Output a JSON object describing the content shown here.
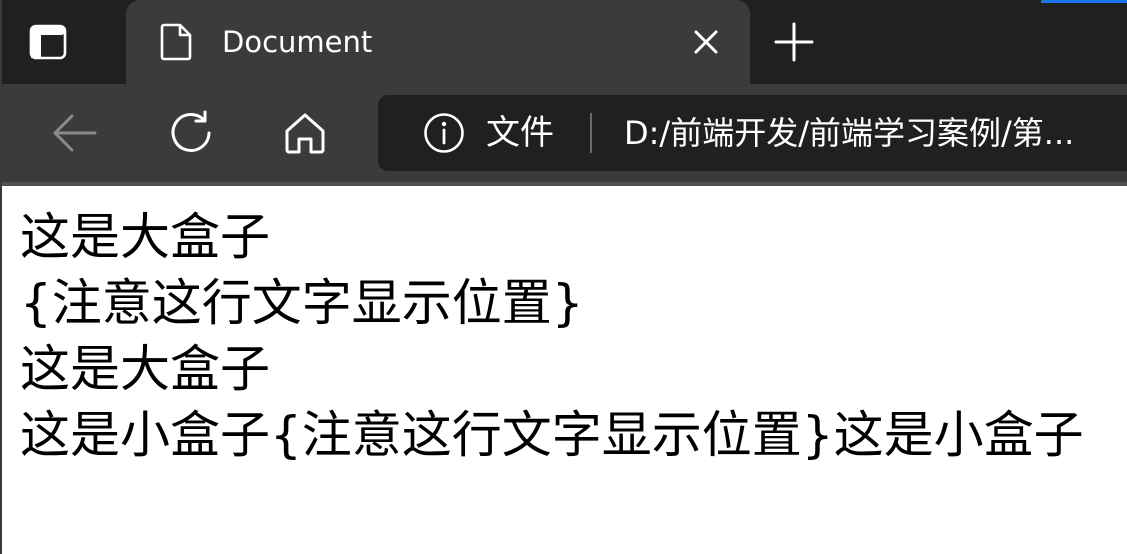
{
  "browser": {
    "accent_color": "#1a73e8",
    "tab": {
      "title": "Document",
      "favicon_icon": "document-icon",
      "close_icon": "close-icon"
    },
    "tab_actions_icon": "tab-actions-icon",
    "new_tab_icon": "plus-icon",
    "toolbar": {
      "back_icon": "arrow-left-icon",
      "reload_icon": "reload-icon",
      "home_icon": "home-icon"
    },
    "address_bar": {
      "info_icon": "info-icon",
      "site_label": "文件",
      "url": "D:/前端开发/前端学习案例/第..."
    }
  },
  "page": {
    "lines": [
      "这是大盒子",
      "{注意这行文字显示位置}",
      "这是大盒子",
      "这是小盒子{注意这行文字显示位置}这是小盒子"
    ]
  }
}
